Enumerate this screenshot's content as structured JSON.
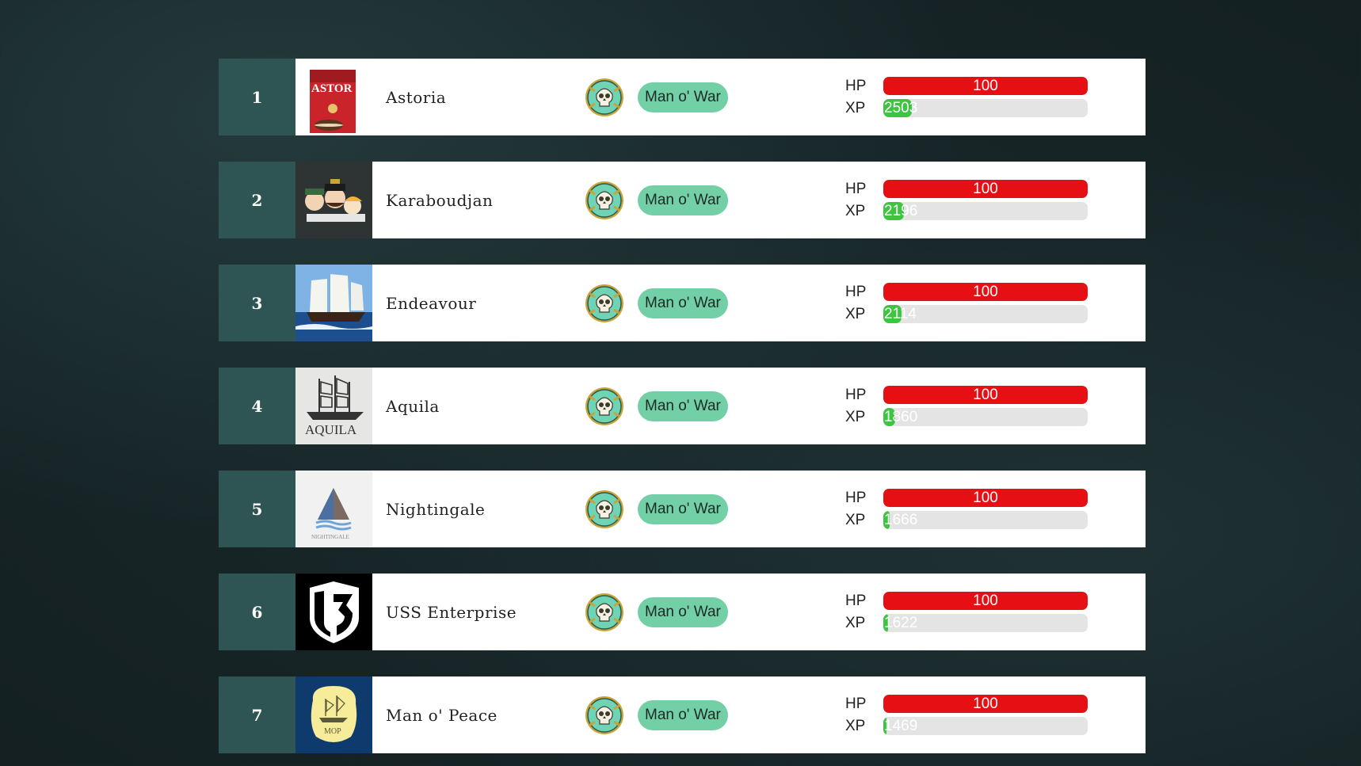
{
  "labels": {
    "hp": "HP",
    "xp": "XP"
  },
  "colors": {
    "rank_bg": "#2e5553",
    "pill_bg": "#72cfa6",
    "hp_bar": "#e60f14",
    "xp_bar": "#3dc441",
    "bar_track": "#e4e4e4"
  },
  "ships": [
    {
      "rank": "1",
      "name": "Astoria",
      "logo": "astoria-logo",
      "ship_class": "Man o' War",
      "class_icon": "skull-emblem-icon",
      "hp": "100",
      "hp_fraction": 1.0,
      "xp": "2503",
      "xp_fraction": 0.14
    },
    {
      "rank": "2",
      "name": "Karaboudjan",
      "logo": "karaboudjan-logo",
      "ship_class": "Man o' War",
      "class_icon": "skull-emblem-icon",
      "hp": "100",
      "hp_fraction": 1.0,
      "xp": "2196",
      "xp_fraction": 0.1
    },
    {
      "rank": "3",
      "name": "Endeavour",
      "logo": "endeavour-logo",
      "ship_class": "Man o' War",
      "class_icon": "skull-emblem-icon",
      "hp": "100",
      "hp_fraction": 1.0,
      "xp": "2114",
      "xp_fraction": 0.09
    },
    {
      "rank": "4",
      "name": "Aquila",
      "logo": "aquila-logo",
      "ship_class": "Man o' War",
      "class_icon": "skull-emblem-icon",
      "hp": "100",
      "hp_fraction": 1.0,
      "xp": "1860",
      "xp_fraction": 0.06
    },
    {
      "rank": "5",
      "name": "Nightingale",
      "logo": "nightingale-logo",
      "ship_class": "Man o' War",
      "class_icon": "skull-emblem-icon",
      "hp": "100",
      "hp_fraction": 1.0,
      "xp": "1666",
      "xp_fraction": 0.03
    },
    {
      "rank": "6",
      "name": "USS Enterprise",
      "logo": "uss-enterprise-logo",
      "ship_class": "Man o' War",
      "class_icon": "skull-emblem-icon",
      "hp": "100",
      "hp_fraction": 1.0,
      "xp": "1622",
      "xp_fraction": 0.025
    },
    {
      "rank": "7",
      "name": "Man o' Peace",
      "logo": "man-o-peace-logo",
      "ship_class": "Man o' War",
      "class_icon": "skull-emblem-icon",
      "hp": "100",
      "hp_fraction": 1.0,
      "xp": "1469",
      "xp_fraction": 0.015
    }
  ],
  "logo_text": {
    "astoria": "ASTOR",
    "aquila": "AQUILA",
    "nightingale": "NIGHTINGALE",
    "mop": "MOP"
  }
}
